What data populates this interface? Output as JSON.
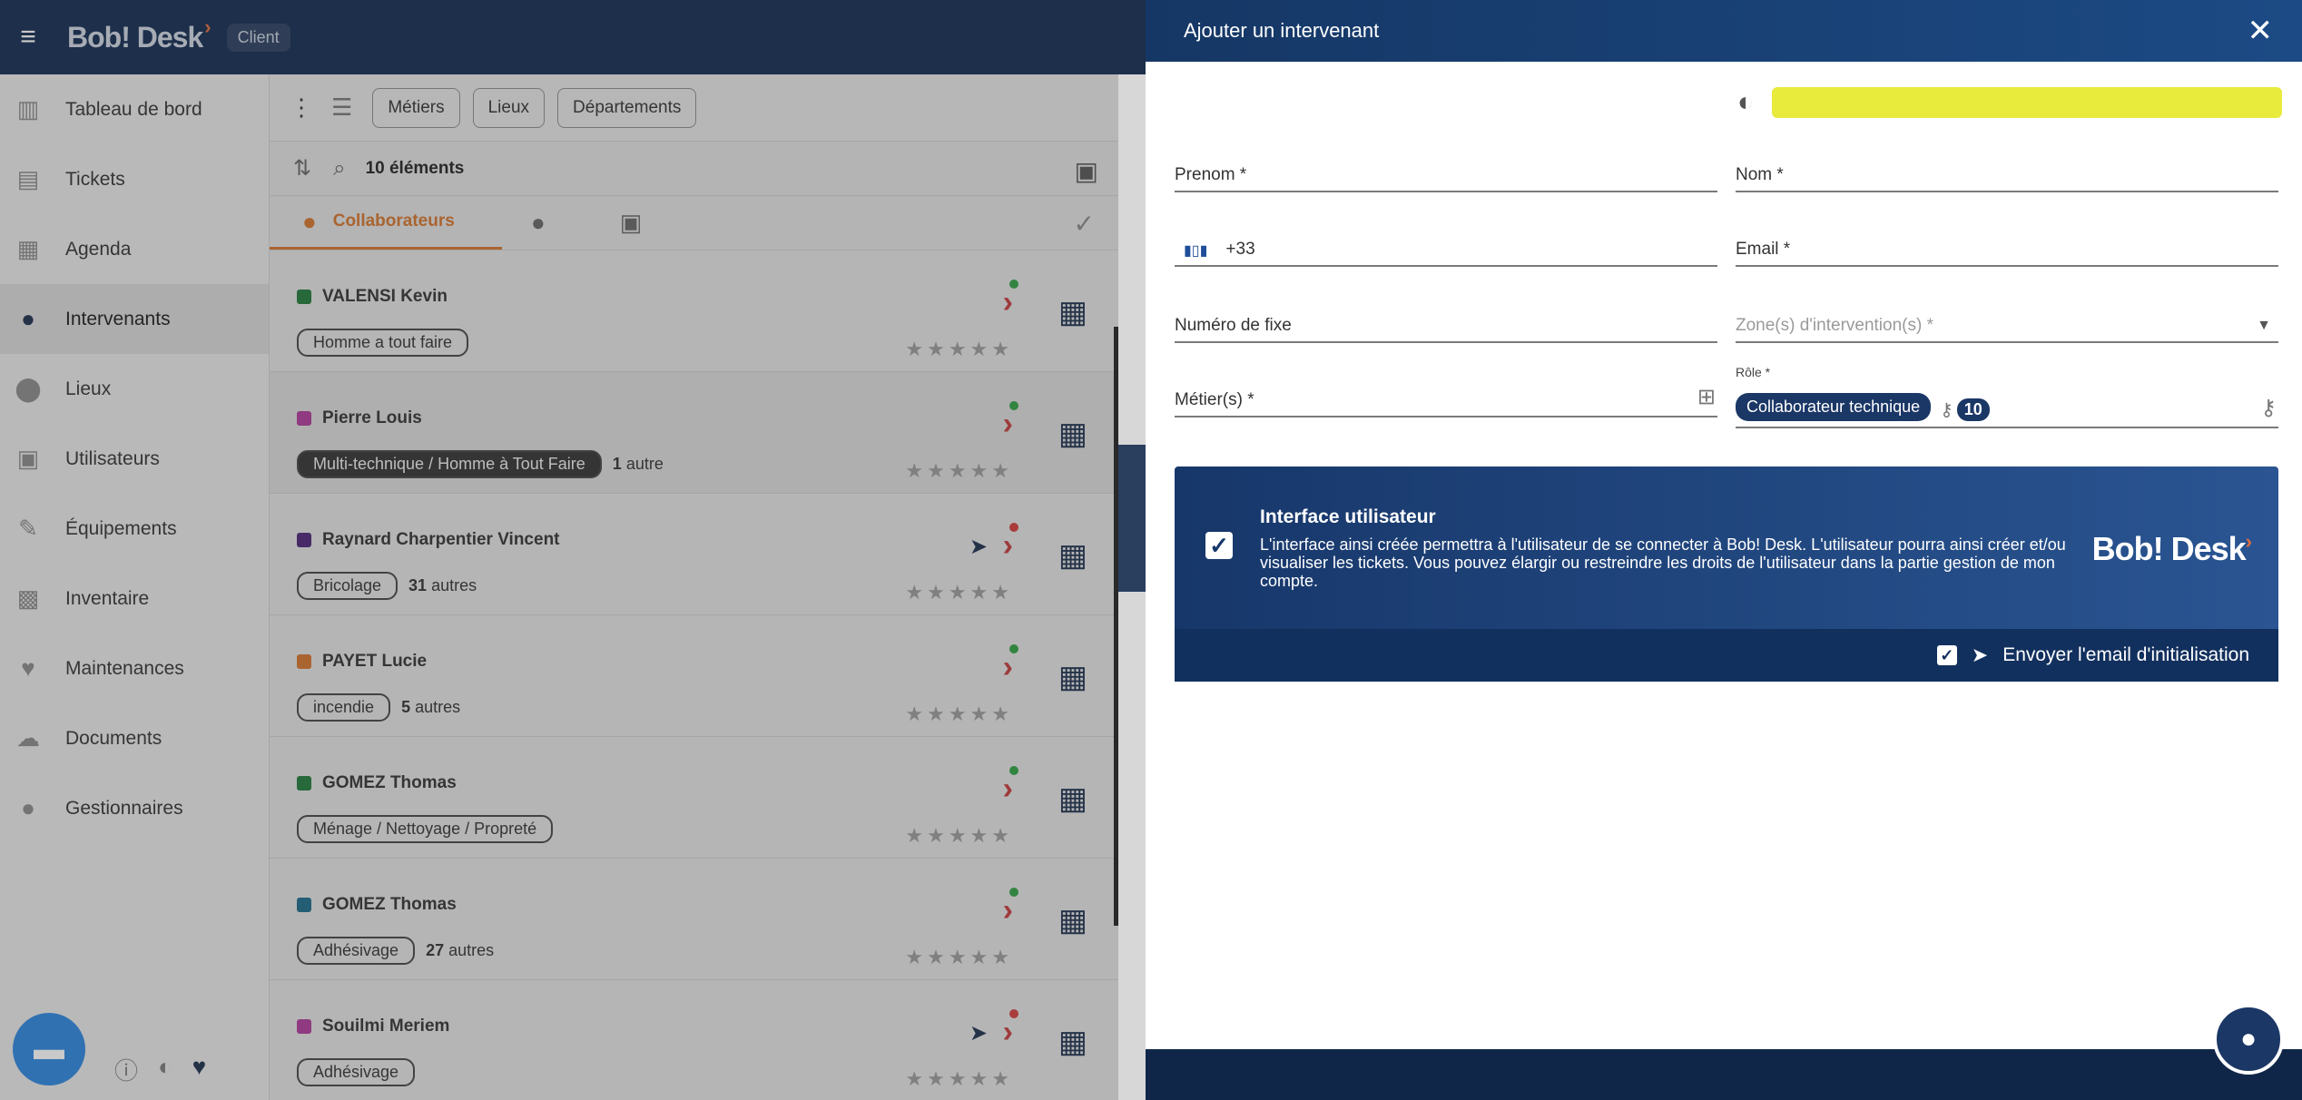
{
  "header": {
    "app_name": "Bob! Desk",
    "client_badge": "Client"
  },
  "sidebar": {
    "items": [
      {
        "label": "Tableau de bord",
        "icon": "bar-chart-icon"
      },
      {
        "label": "Tickets",
        "icon": "inbox-icon"
      },
      {
        "label": "Agenda",
        "icon": "calendar-icon"
      },
      {
        "label": "Intervenants",
        "icon": "worker-icon",
        "active": true
      },
      {
        "label": "Lieux",
        "icon": "map-pin-icon"
      },
      {
        "label": "Utilisateurs",
        "icon": "users-icon"
      },
      {
        "label": "Équipements",
        "icon": "wrench-icon"
      },
      {
        "label": "Inventaire",
        "icon": "warehouse-icon"
      },
      {
        "label": "Maintenances",
        "icon": "heartbeat-icon"
      },
      {
        "label": "Documents",
        "icon": "cloud-icon"
      },
      {
        "label": "Gestionnaires",
        "icon": "manager-icon"
      }
    ]
  },
  "filters": {
    "metiers": "Métiers",
    "lieux": "Lieux",
    "departements": "Départements"
  },
  "list": {
    "count": "10 éléments",
    "tab_active": "Collaborateurs",
    "rows": [
      {
        "name": "VALENSI Kevin",
        "color": "#1f7a3a",
        "tag": "Homme a tout faire",
        "more_n": "",
        "more_text": "",
        "dot": "#2ea043",
        "send": false
      },
      {
        "name": "Pierre Louis",
        "color": "#b0399c",
        "tag": "Multi-technique / Homme à Tout Faire",
        "more_n": "1",
        "more_text": "autre",
        "dot": "#2ea043",
        "send": false,
        "dark": true
      },
      {
        "name": "Raynard Charpentier Vincent",
        "color": "#4b2378",
        "tag": "Bricolage",
        "more_n": "31",
        "more_text": "autres",
        "dot": "#d43c3c",
        "send": true
      },
      {
        "name": "PAYET Lucie",
        "color": "#d4742b",
        "tag": "incendie",
        "more_n": "5",
        "more_text": "autres",
        "dot": "#2ea043",
        "send": false
      },
      {
        "name": "GOMEZ Thomas",
        "color": "#1f7a3a",
        "tag": "Ménage / Nettoyage / Propreté",
        "more_n": "",
        "more_text": "",
        "dot": "#2ea043",
        "send": false
      },
      {
        "name": "GOMEZ Thomas",
        "color": "#1a6b8a",
        "tag": "Adhésivage",
        "more_n": "27",
        "more_text": "autres",
        "dot": "#2ea043",
        "send": false
      },
      {
        "name": "Souilmi Meriem",
        "color": "#b0399c",
        "tag": "Adhésivage",
        "more_n": "",
        "more_text": "",
        "dot": "#d43c3c",
        "send": true
      }
    ]
  },
  "drawer": {
    "title": "Ajouter un intervenant",
    "color_value": "#e8ea3c",
    "prenom": "Prenom *",
    "nom": "Nom *",
    "phone_prefix": "+33",
    "email": "Email *",
    "fixe": "Numéro de fixe",
    "zones": "Zone(s) d'intervention(s) *",
    "metiers": "Métier(s) *",
    "role_label": "Rôle *",
    "role_value": "Collaborateur technique",
    "role_count": "10",
    "ui_card": {
      "title": "Interface utilisateur",
      "description": "L'interface ainsi créée permettra à l'utilisateur de se connecter à Bob! Desk. L'utilisateur pourra ainsi créer et/ou visualiser les tickets. Vous pouvez élargir ou restreindre les droits de l'utilisateur dans la partie gestion de mon compte.",
      "logo": "Bob! Desk",
      "send_email_label": "Envoyer l'email d'initialisation"
    }
  }
}
